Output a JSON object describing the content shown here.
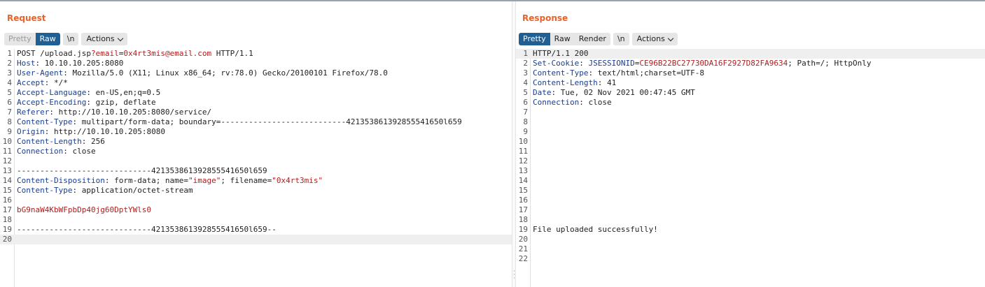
{
  "request": {
    "title": "Request",
    "view_buttons": [
      "Pretty",
      "Raw"
    ],
    "active_view": "Raw",
    "newline_button": "\\n",
    "actions_label": "Actions",
    "lines": [
      {
        "segs": [
          {
            "c": "t",
            "x": "POST /upload.jsp"
          },
          {
            "c": "r",
            "x": "?email"
          },
          {
            "c": "t",
            "x": "="
          },
          {
            "c": "r",
            "x": "0x4rt3mis@email.com"
          },
          {
            "c": "t",
            "x": " HTTP/1.1"
          }
        ]
      },
      {
        "segs": [
          {
            "c": "k",
            "x": "Host"
          },
          {
            "c": "t",
            "x": ": 10.10.10.205:8080"
          }
        ]
      },
      {
        "segs": [
          {
            "c": "k",
            "x": "User-Agent"
          },
          {
            "c": "t",
            "x": ": Mozilla/5.0 (X11; Linux x86_64; rv:78.0) Gecko/20100101 Firefox/78.0"
          }
        ]
      },
      {
        "segs": [
          {
            "c": "k",
            "x": "Accept"
          },
          {
            "c": "t",
            "x": ": */*"
          }
        ]
      },
      {
        "segs": [
          {
            "c": "k",
            "x": "Accept-Language"
          },
          {
            "c": "t",
            "x": ": en-US,en;q=0.5"
          }
        ]
      },
      {
        "segs": [
          {
            "c": "k",
            "x": "Accept-Encoding"
          },
          {
            "c": "t",
            "x": ": gzip, deflate"
          }
        ]
      },
      {
        "segs": [
          {
            "c": "k",
            "x": "Referer"
          },
          {
            "c": "t",
            "x": ": http://10.10.10.205:8080/service/"
          }
        ]
      },
      {
        "segs": [
          {
            "c": "k",
            "x": "Content-Type"
          },
          {
            "c": "t",
            "x": ": multipart/form-data; boundary=---------------------------421353861392855541650l659"
          }
        ]
      },
      {
        "segs": [
          {
            "c": "k",
            "x": "Origin"
          },
          {
            "c": "t",
            "x": ": http://10.10.10.205:8080"
          }
        ]
      },
      {
        "segs": [
          {
            "c": "k",
            "x": "Content-Length"
          },
          {
            "c": "t",
            "x": ": 256"
          }
        ]
      },
      {
        "segs": [
          {
            "c": "k",
            "x": "Connection"
          },
          {
            "c": "t",
            "x": ": close"
          }
        ]
      },
      {
        "segs": []
      },
      {
        "segs": [
          {
            "c": "t",
            "x": "-----------------------------421353861392855541650l659"
          }
        ]
      },
      {
        "segs": [
          {
            "c": "k",
            "x": "Content-Disposition"
          },
          {
            "c": "t",
            "x": ": form-data; name="
          },
          {
            "c": "r",
            "x": "\"image\""
          },
          {
            "c": "t",
            "x": "; filename="
          },
          {
            "c": "r",
            "x": "\"0x4rt3mis\""
          }
        ]
      },
      {
        "segs": [
          {
            "c": "k",
            "x": "Content-Type"
          },
          {
            "c": "t",
            "x": ": application/octet-stream"
          }
        ]
      },
      {
        "segs": []
      },
      {
        "segs": [
          {
            "c": "r",
            "x": "bG9naW4KbWFpbDp40jg60DptYWls0"
          }
        ]
      },
      {
        "segs": []
      },
      {
        "segs": [
          {
            "c": "t",
            "x": "-----------------------------421353861392855541650l659--"
          }
        ]
      },
      {
        "segs": [],
        "highlight": true
      }
    ]
  },
  "response": {
    "title": "Response",
    "view_buttons": [
      "Pretty",
      "Raw",
      "Render"
    ],
    "active_view": "Pretty",
    "newline_button": "\\n",
    "actions_label": "Actions",
    "lines": [
      {
        "segs": [
          {
            "c": "t",
            "x": "HTTP/1.1 200"
          }
        ],
        "highlight": true
      },
      {
        "segs": [
          {
            "c": "k",
            "x": "Set-Cookie"
          },
          {
            "c": "t",
            "x": ": "
          },
          {
            "c": "k",
            "x": "JSESSIONID"
          },
          {
            "c": "t",
            "x": "="
          },
          {
            "c": "r",
            "x": "CE96B22BC27730DA16F2927D82FA9634"
          },
          {
            "c": "t",
            "x": "; Path=/; HttpOnly"
          }
        ]
      },
      {
        "segs": [
          {
            "c": "k",
            "x": "Content-Type"
          },
          {
            "c": "t",
            "x": ": text/html;charset=UTF-8"
          }
        ]
      },
      {
        "segs": [
          {
            "c": "k",
            "x": "Content-Length"
          },
          {
            "c": "t",
            "x": ": 41"
          }
        ]
      },
      {
        "segs": [
          {
            "c": "k",
            "x": "Date"
          },
          {
            "c": "t",
            "x": ": Tue, 02 Nov 2021 00:47:45 GMT"
          }
        ]
      },
      {
        "segs": [
          {
            "c": "k",
            "x": "Connection"
          },
          {
            "c": "t",
            "x": ": close"
          }
        ]
      },
      {
        "segs": []
      },
      {
        "segs": []
      },
      {
        "segs": []
      },
      {
        "segs": []
      },
      {
        "segs": []
      },
      {
        "segs": []
      },
      {
        "segs": []
      },
      {
        "segs": []
      },
      {
        "segs": []
      },
      {
        "segs": []
      },
      {
        "segs": []
      },
      {
        "segs": []
      },
      {
        "segs": [
          {
            "c": "t",
            "x": "File uploaded successfully!"
          }
        ]
      },
      {
        "segs": []
      },
      {
        "segs": []
      },
      {
        "segs": []
      }
    ]
  },
  "colors": {
    "accent": "#e8632b",
    "active_button": "#1f5f94",
    "header_key": "#1a3d8f",
    "value_red": "#b01e1e"
  }
}
